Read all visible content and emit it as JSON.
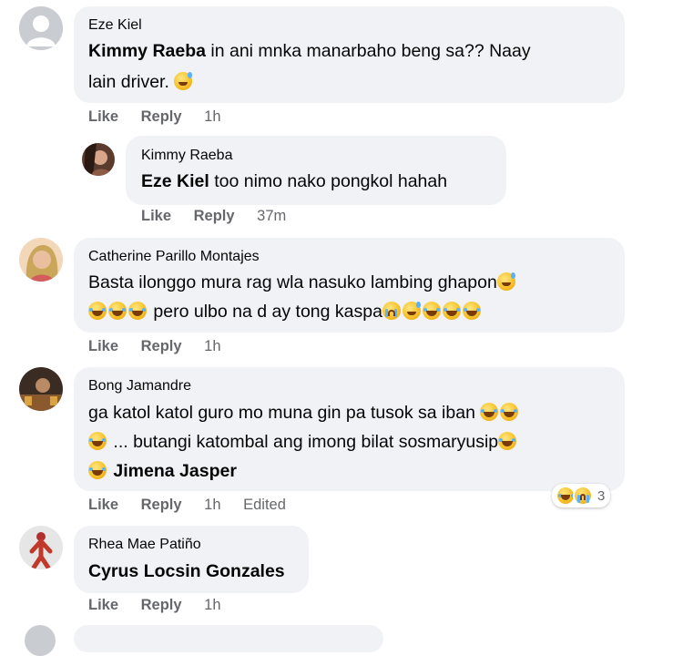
{
  "comments": [
    {
      "author": "Eze Kiel",
      "line1": {
        "mention": "Kimmy Raeba",
        "text": " in ani mnka manarbaho beng sa?? Naay"
      },
      "line2": "lain driver. ",
      "actions": {
        "like": "Like",
        "reply": "Reply",
        "time": "1h"
      }
    },
    {
      "author": "Kimmy Raeba",
      "line1": {
        "mention": "Eze Kiel",
        "text": " too nimo nako pongkol hahah"
      },
      "actions": {
        "like": "Like",
        "reply": "Reply",
        "time": "37m"
      }
    },
    {
      "author": "Catherine Parillo Montajes",
      "line1": "Basta ilonggo mura rag wla nasuko lambing ghapon",
      "line2": " pero ulbo na d ay tong kaspa",
      "actions": {
        "like": "Like",
        "reply": "Reply",
        "time": "1h"
      }
    },
    {
      "author": "Bong Jamandre",
      "line1": "ga katol katol guro mo muna gin pa tusok sa iban ",
      "line2": " ... butangi katombal ang imong bilat sosmaryusip",
      "line3": {
        "mention": "Jimena Jasper"
      },
      "actions": {
        "like": "Like",
        "reply": "Reply",
        "time": "1h",
        "edited": "Edited"
      },
      "reactions": {
        "count": "3",
        "icons": [
          "laugh-emoji",
          "wow-emoji"
        ]
      }
    },
    {
      "author": "Rhea Mae Patiño",
      "line1": {
        "mention": "Cyrus Locsin Gonzales"
      },
      "actions": {
        "like": "Like",
        "reply": "Reply",
        "time": "1h"
      }
    }
  ],
  "colors": {
    "bubble": "#f0f2f5",
    "meta_text": "#65676b",
    "text": "#050505"
  }
}
